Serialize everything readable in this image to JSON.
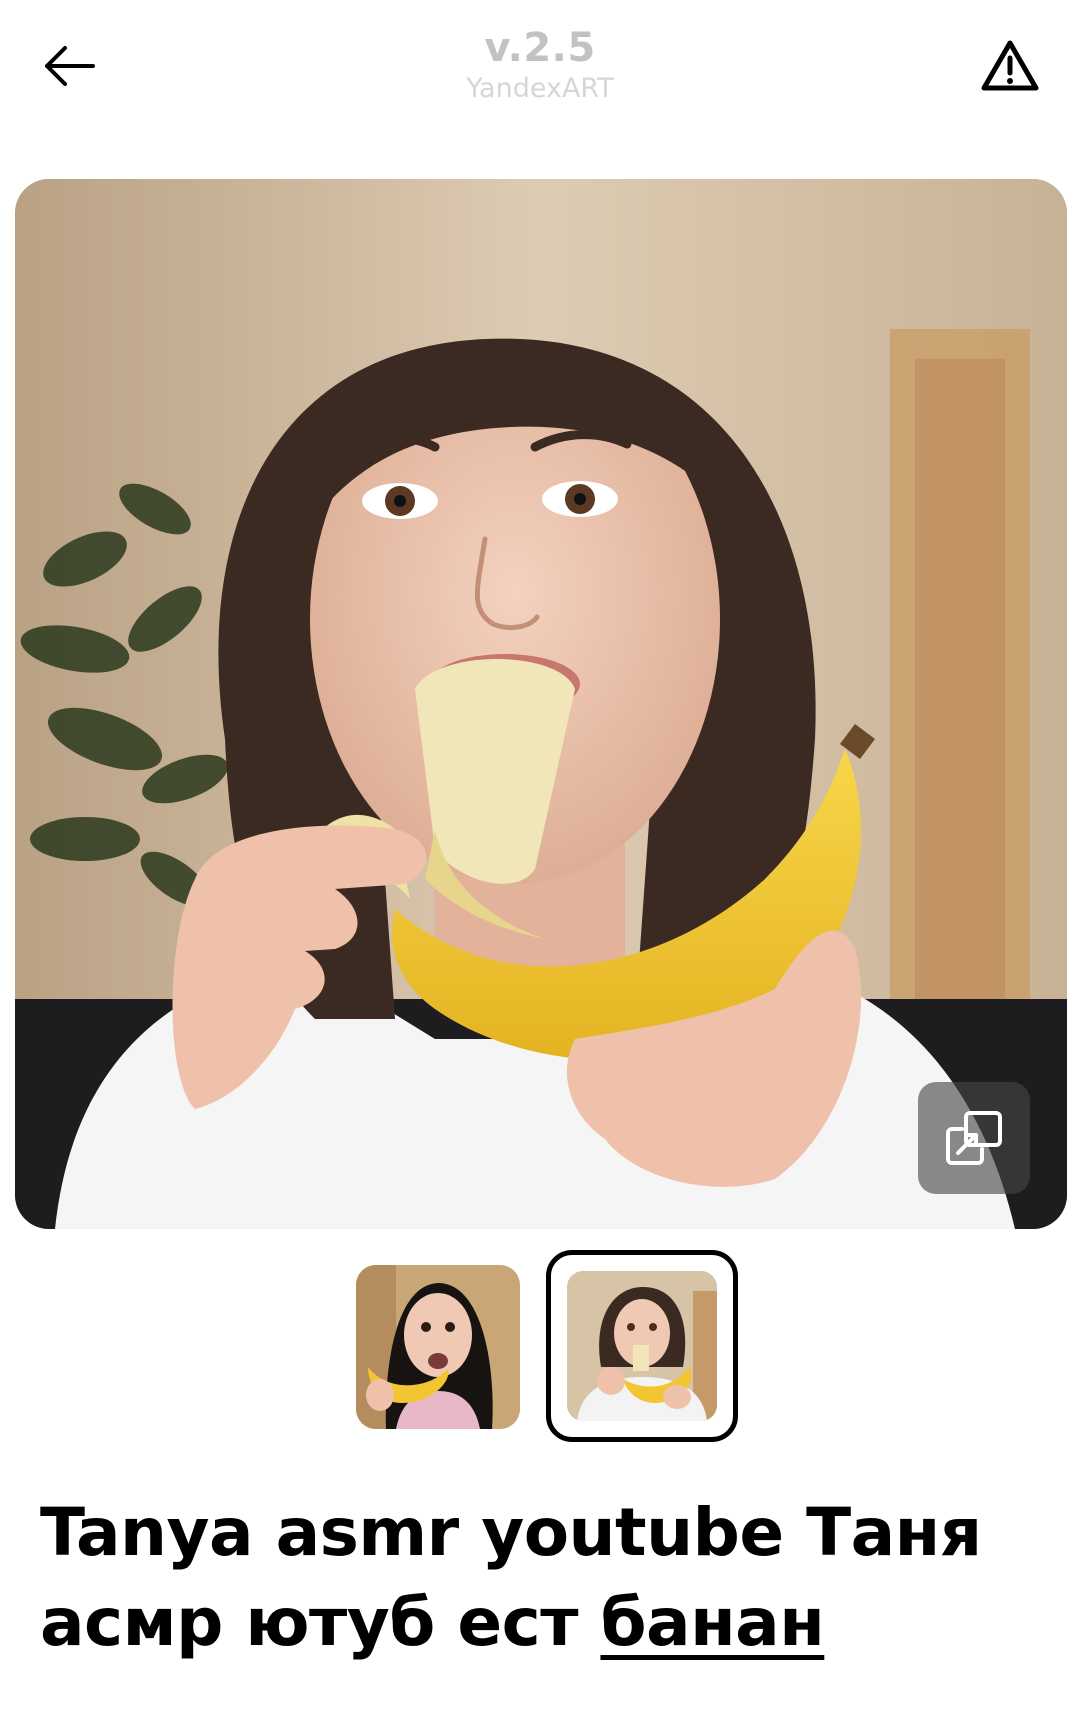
{
  "header": {
    "version": "v.2.5",
    "model": "YandexART",
    "back_icon": "arrow-left-icon",
    "report_icon": "warning-triangle-icon"
  },
  "main_image": {
    "alt": "Generated image",
    "expand_icon": "expand-copy-icon"
  },
  "thumbnails": [
    {
      "selected": false
    },
    {
      "selected": true
    }
  ],
  "prompt": {
    "text_before_link": "Tanya asmr youtube Таня асмр ютуб ест ",
    "link_word": "банан"
  },
  "colors": {
    "background": "#ffffff",
    "header_text": "#c2c2c2",
    "subheader_text": "#d6d6d6",
    "prompt_text": "#000000",
    "expand_button_bg": "#464646",
    "banana": "#f2c531"
  }
}
